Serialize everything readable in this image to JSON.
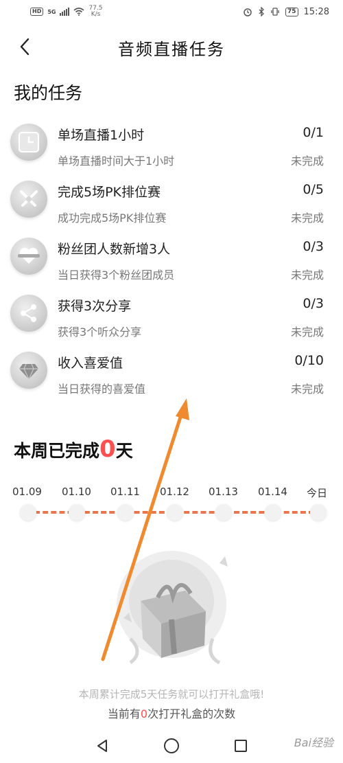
{
  "status_bar": {
    "hd": "HD",
    "network": "5G",
    "speed_value": "77.5",
    "speed_unit": "K/s",
    "battery": "75",
    "time": "15:28"
  },
  "header": {
    "title": "音频直播任务"
  },
  "my_tasks": {
    "title": "我的任务",
    "items": [
      {
        "icon": "clock-icon",
        "name": "单场直播1小时",
        "desc": "单场直播时间大于1小时",
        "progress": "0/1",
        "status": "未完成"
      },
      {
        "icon": "swords-icon",
        "name": "完成5场PK排位赛",
        "desc": "成功完成5场PK排位赛",
        "progress": "0/5",
        "status": "未完成"
      },
      {
        "icon": "heart-icon",
        "name": "粉丝团人数新增3人",
        "desc": "当日获得3个粉丝团成员",
        "progress": "0/3",
        "status": "未完成"
      },
      {
        "icon": "share-icon",
        "name": "获得3次分享",
        "desc": "获得3个听众分享",
        "progress": "0/3",
        "status": "未完成"
      },
      {
        "icon": "diamond-icon",
        "name": "收入喜爱值",
        "desc": "当日获得的喜爱值",
        "progress": "0/10",
        "status": "未完成"
      }
    ]
  },
  "week": {
    "title_prefix": "本周已完成",
    "count": "0",
    "title_suffix": "天",
    "dates": [
      "01.09",
      "01.10",
      "01.11",
      "01.12",
      "01.13",
      "01.14",
      "今日"
    ]
  },
  "footer": {
    "line1": "本周累计完成5天任务就可以打开礼盒哦!",
    "line2_prefix": "当前有",
    "line2_count": "0",
    "line2_suffix": "次打开礼盒的次数"
  },
  "watermark": "Bai经验",
  "colors": {
    "accent_red": "#ff4f4f",
    "timeline": "#e9764c",
    "annotation_arrow": "#f08a2e"
  }
}
